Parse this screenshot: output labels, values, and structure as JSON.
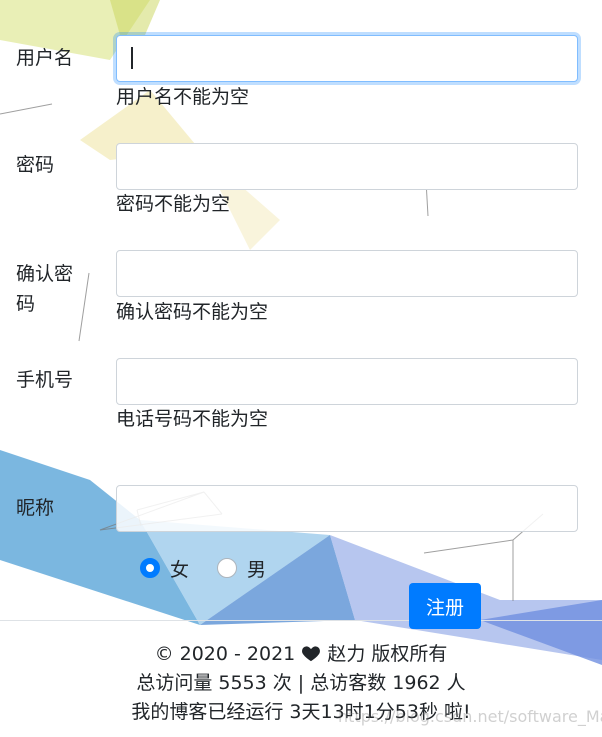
{
  "form": {
    "username": {
      "label": "用户名",
      "value": "",
      "error": "用户名不能为空"
    },
    "password": {
      "label": "密码",
      "value": "",
      "error": "密码不能为空"
    },
    "confirm": {
      "label": "确认密码",
      "value": "",
      "error": "确认密码不能为空"
    },
    "phone": {
      "label": "手机号",
      "value": "",
      "error": "电话号码不能为空"
    },
    "nickname": {
      "label": "昵称",
      "value": ""
    },
    "gender": {
      "options": [
        "女",
        "男"
      ],
      "selected": "女"
    },
    "submit_label": "注册"
  },
  "footer": {
    "copyright_prefix": "© 2020 - 2021",
    "copyright_suffix": "赵力 版权所有",
    "visits": "总访问量 5553 次 | 总访客数 1962 人",
    "uptime": "我的博客已经运行  3天13时1分53秒  啦!",
    "watermark": "https://blog.csdn.net/software_Manito"
  },
  "colors": {
    "accent": "#007bff",
    "input_border": "#ced4da",
    "focus_border": "#80bdff"
  },
  "icons": {
    "heart": "heart-icon"
  }
}
